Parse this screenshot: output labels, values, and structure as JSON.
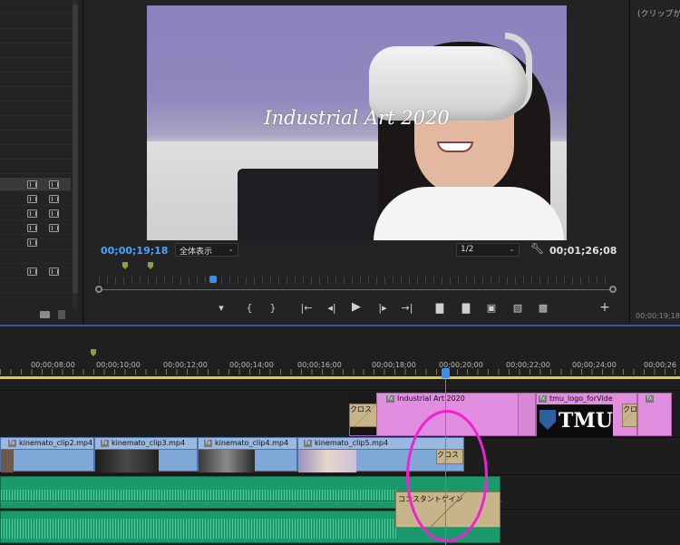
{
  "monitor": {
    "overlay_title": "Industrial Art 2020",
    "current_timecode": "00;00;19;18",
    "zoom_select": "全体表示",
    "resolution_select": "1/2",
    "duration_timecode": "00;01;26;08",
    "controls": [
      "add-marker",
      "mark-in",
      "mark-out",
      "go-to-in",
      "step-back",
      "play",
      "step-forward",
      "go-to-out",
      "lift",
      "extract",
      "export-frame",
      "comparison-view",
      "toggle-proxies",
      "add-button"
    ]
  },
  "source_panel": {
    "header_text": "(クリップが",
    "timecode": "00;00;19;18"
  },
  "timeline": {
    "ruler_labels": [
      "00;00;08;00",
      "00;00;10;00",
      "00;00;12;00",
      "00;00;14;00",
      "00;00;16;00",
      "00;00;18;00",
      "00;00;20;00",
      "00;00;22;00",
      "00;00;24;00",
      "00;00;26"
    ],
    "v2_clips": {
      "industrial": "Industrial Art 2020",
      "logo": "tmu_logo_forVide",
      "logo_text": "TMU",
      "industrial_thumb_text": "Industrial Art 2020"
    },
    "v1_clips": [
      "kinemato_clip2.mp4",
      "kinemato_clip3.mp4",
      "kinemato_clip4.mp4",
      "kinemato_clip5.mp4"
    ],
    "transitions": {
      "v2_left": "クロス",
      "v2_right": "クロ",
      "v1": "クロス",
      "audio": "コンスタントゲイン"
    }
  },
  "colors": {
    "accent": "#4aa3ff",
    "annotation_circle": "#f21fd4",
    "graphic_clip": "#e28ee0",
    "video_clip": "#7fa7d8",
    "audio_clip": "#1a9a6a"
  }
}
